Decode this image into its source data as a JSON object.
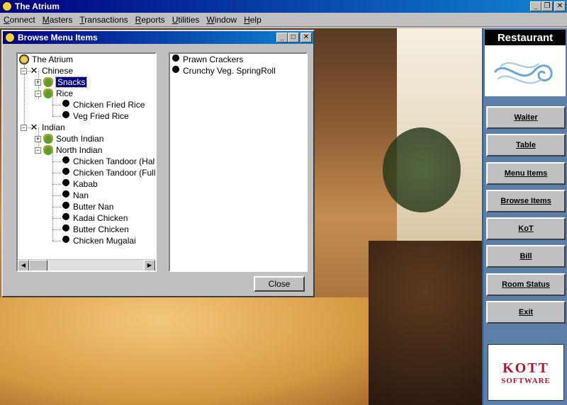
{
  "app": {
    "title": "The Atrium",
    "minimize": "_",
    "restore": "❐",
    "close": "✕"
  },
  "menubar": [
    "Connect",
    "Masters",
    "Transactions",
    "Reports",
    "Utilities",
    "Window",
    "Help"
  ],
  "dialog": {
    "title": "Browse Menu Items",
    "close_label": "Close",
    "tree": {
      "root": "The Atrium",
      "chinese": "Chinese",
      "snacks": "Snacks",
      "rice": "Rice",
      "rice_items": [
        "Chicken Fried Rice",
        "Veg Fried Rice"
      ],
      "indian": "Indian",
      "south_indian": "South Indian",
      "north_indian": "North Indian",
      "north_items": [
        "Chicken Tandoor (Half)",
        "Chicken Tandoor (Full)",
        "Kabab",
        "Nan",
        "Butter Nan",
        "Kadai Chicken",
        "Butter Chicken",
        "Chicken Mugalai"
      ]
    },
    "items": [
      "Prawn Crackers",
      "Crunchy Veg. SpringRoll"
    ]
  },
  "side_panel": {
    "header": "Restaurant",
    "buttons": [
      "Waiter",
      "Table",
      "Menu Items",
      "Browse Items",
      "KoT",
      "Bill",
      "Room Status",
      "Exit"
    ],
    "logo_text": "KOTT",
    "logo_sub": "SOFTWARE"
  }
}
